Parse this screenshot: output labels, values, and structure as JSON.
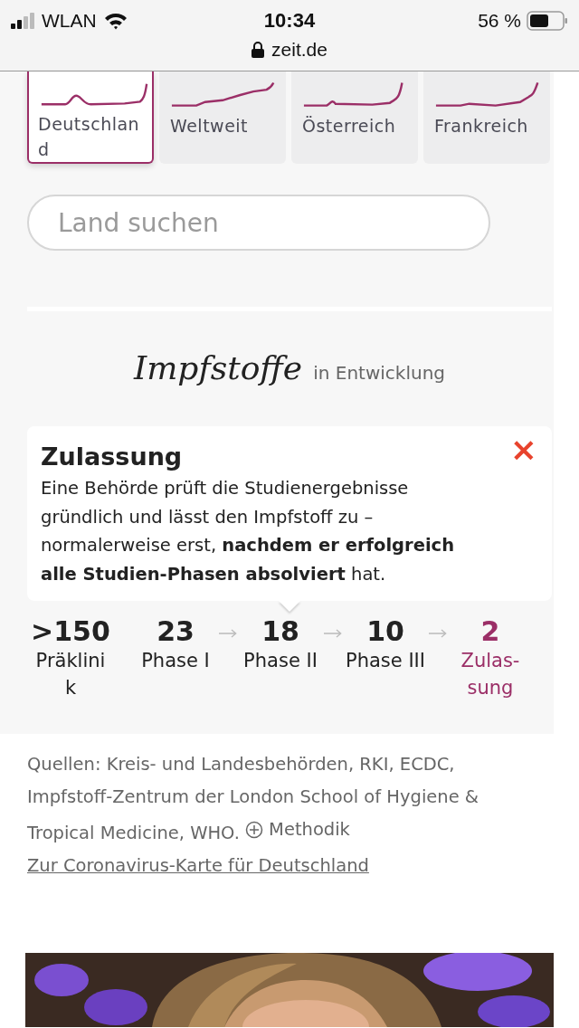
{
  "status_bar": {
    "carrier": "WLAN",
    "time": "10:34",
    "battery": "56 %"
  },
  "address_bar": {
    "url": "zeit.de"
  },
  "country_tabs": [
    {
      "label": "Deutschland",
      "selected": true
    },
    {
      "label": "Weltweit",
      "selected": false
    },
    {
      "label": "Österreich",
      "selected": false
    },
    {
      "label": "Frankreich",
      "selected": false
    }
  ],
  "search": {
    "placeholder": "Land suchen"
  },
  "section": {
    "title": "Impfstoffe",
    "subtitle": "in Entwicklung"
  },
  "tooltip": {
    "title": "Zulassung",
    "body": "Eine Behörde prüft die Studienergebnisse gründlich und lässt den Impfstoff zu – normalerweise erst, **nachdem er erfolgreich alle Studien-Phasen absolviert** hat.",
    "close": "×"
  },
  "stages": [
    {
      "count": ">150",
      "label": "Präklinik",
      "arrow": false,
      "selected": false
    },
    {
      "count": "23",
      "label": "Phase I",
      "arrow": false,
      "selected": false
    },
    {
      "count": "18",
      "label": "Phase II",
      "arrow": true,
      "selected": false
    },
    {
      "count": "10",
      "label": "Phase III",
      "arrow": true,
      "selected": false
    },
    {
      "count": "2",
      "label": "Zulas-sung",
      "arrow": true,
      "selected": true
    }
  ],
  "sources": {
    "text": "Quellen: Kreis- und Landesbehörden, RKI, ECDC, Impfstoff-Zentrum der London School of Hygiene & Tropical Medicine, WHO.",
    "method_link": "Methodik",
    "map_link": "Zur Coronavirus-Karte für Deutschland"
  }
}
